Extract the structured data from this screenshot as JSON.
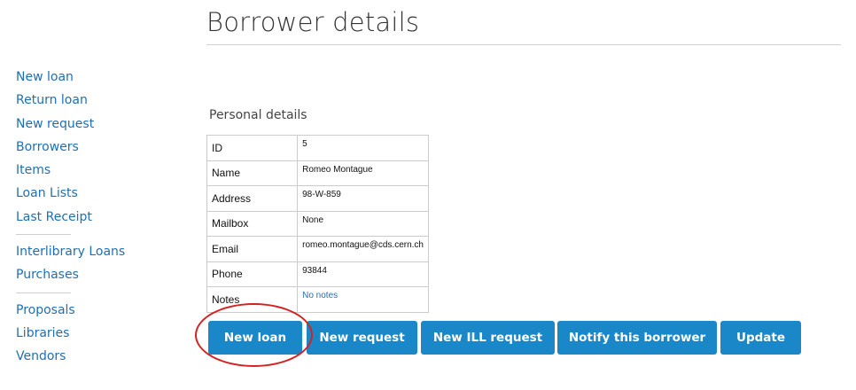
{
  "page": {
    "title": "Borrower details"
  },
  "sidebar": {
    "groups": [
      [
        "New loan",
        "Return loan",
        "New request",
        "Borrowers",
        "Items",
        "Loan Lists",
        "Last Receipt"
      ],
      [
        "Interlibrary Loans",
        "Purchases"
      ],
      [
        "Proposals",
        "Libraries",
        "Vendors"
      ]
    ]
  },
  "personal": {
    "heading": "Personal details",
    "rows": [
      {
        "label": "ID",
        "value": "5"
      },
      {
        "label": "Name",
        "value": "Romeo Montague"
      },
      {
        "label": "Address",
        "value": "98-W-859"
      },
      {
        "label": "Mailbox",
        "value": "None"
      },
      {
        "label": "Email",
        "value": "romeo.montague@cds.cern.ch"
      },
      {
        "label": "Phone",
        "value": "93844"
      },
      {
        "label": "Notes",
        "value": "No notes"
      }
    ]
  },
  "actions": {
    "new_loan": "New loan",
    "new_request": "New request",
    "new_ill_request": "New ILL request",
    "notify_borrower": "Notify this borrower",
    "update": "Update"
  },
  "colors": {
    "link": "#1f6fb2",
    "button": "#1a87c9",
    "highlight_circle": "#d32222"
  }
}
